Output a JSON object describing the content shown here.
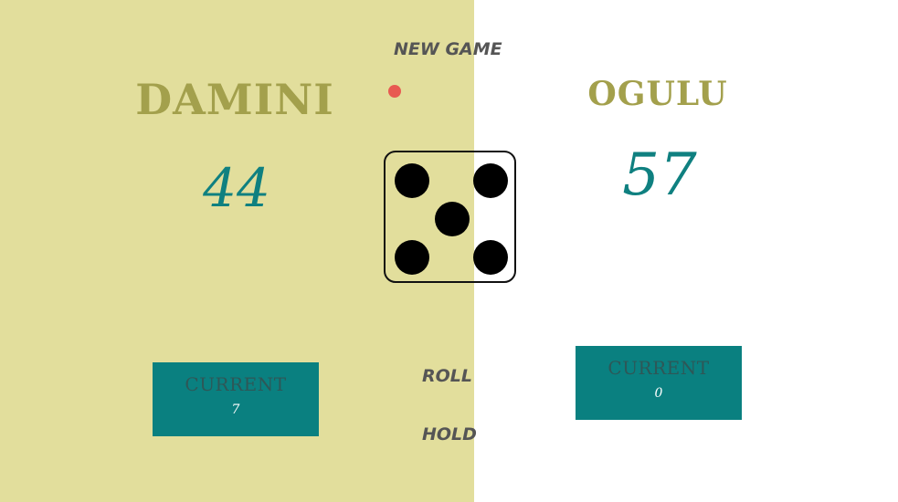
{
  "game": {
    "new_game_label": "NEW GAME",
    "roll_label": "ROLL",
    "hold_label": "HOLD",
    "active_player": "player1",
    "dice_value": 5
  },
  "player1": {
    "name": "DAMINI",
    "score": "44",
    "current_label": "CURRENT",
    "current_value": "7"
  },
  "player2": {
    "name": "OGULU",
    "score": "57",
    "current_label": "CURRENT",
    "current_value": "0"
  },
  "colors": {
    "active_panel": "#e2de9c",
    "inactive_panel": "#ffffff",
    "name_color": "#a3a04c",
    "score_color": "#0f8080",
    "current_box": "#0a8080",
    "active_indicator": "#e85a52"
  },
  "icons": {
    "dice": "dice-five-icon",
    "active": "active-player-dot-icon"
  }
}
